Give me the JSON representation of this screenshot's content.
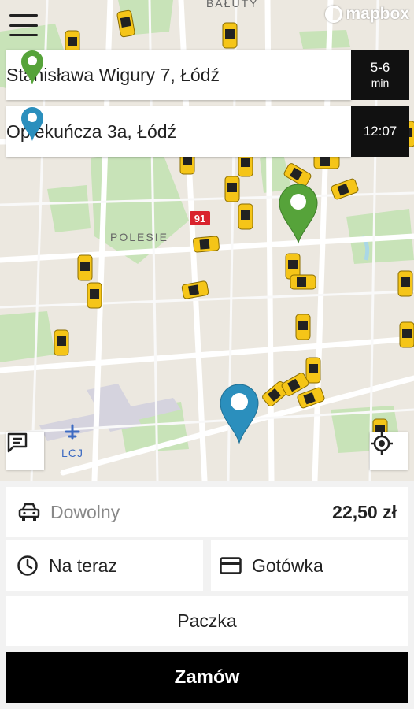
{
  "map": {
    "attribution": "mapbox",
    "labels": {
      "district_north": "BAŁUTY",
      "district_west": "POLESIE",
      "airport": "LCJ",
      "road_number": "91"
    },
    "icons": {
      "menu": "hamburger-menu-icon",
      "pickup_pin": "green-pin-icon",
      "destination_pin": "blue-pin-icon",
      "chat": "chat-icon",
      "locate": "locate-icon",
      "taxi": "taxi-icon"
    },
    "colors": {
      "pickup": "#56a33a",
      "destination": "#2b8fbd",
      "taxi": "#f5c518",
      "park": "#c8e3b8",
      "water": "#a9d7e6",
      "road_major": "#ffffff"
    }
  },
  "route": {
    "pickup_address": "Stanisława Wigury 7, Łódź",
    "pickup_eta_line1": "5-6",
    "pickup_eta_line2": "min",
    "destination_address": "Opiekuńcza 3a, Łódź",
    "destination_time": "12:07"
  },
  "order": {
    "car_type": "Dowolny",
    "price": "22,50 zł",
    "when": "Na teraz",
    "payment": "Gotówka",
    "extra": "Paczka",
    "submit": "Zamów"
  }
}
